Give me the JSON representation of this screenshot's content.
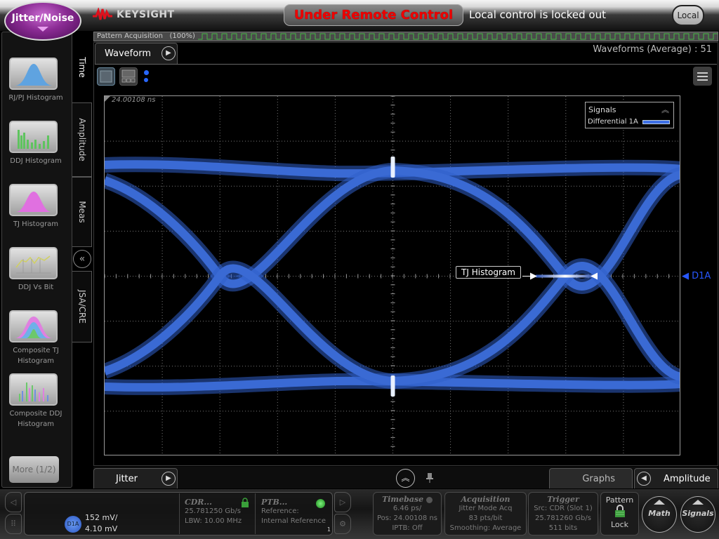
{
  "header": {
    "mode_button": "Jitter/Noise",
    "brand": "KEYSIGHT",
    "remote_status": "Under Remote Control",
    "lock_message": "Local control is locked out",
    "local_button": "Local"
  },
  "pattern_acquisition": {
    "label": "Pattern Acquisition",
    "percent": "(100%)",
    "progress_fraction": 1.0
  },
  "left_panel": {
    "tiles": [
      {
        "label": "RJ/PJ Histogram",
        "icon": "rj-pj-histogram-icon"
      },
      {
        "label": "DDJ Histogram",
        "icon": "ddj-histogram-icon"
      },
      {
        "label": "TJ Histogram",
        "icon": "tj-histogram-icon"
      },
      {
        "label": "DDJ Vs Bit",
        "icon": "ddj-vs-bit-icon"
      },
      {
        "label": "Composite TJ Histogram",
        "icon": "composite-tj-histogram-icon"
      },
      {
        "label": "Composite DDJ Histogram",
        "icon": "composite-ddj-histogram-icon"
      }
    ],
    "more_button": "More (1/2)"
  },
  "vertical_tabs": [
    {
      "label": "Time",
      "active": true
    },
    {
      "label": "Amplitude",
      "active": false
    },
    {
      "label": "Meas",
      "active": false
    },
    {
      "label": "JSA/CRE",
      "active": false
    }
  ],
  "waveform_panel": {
    "tab_label": "Waveform",
    "waveform_count": "Waveforms (Average) : 51",
    "time_position": "24.00108 ns",
    "legend": {
      "title": "Signals",
      "signal": "Differential 1A",
      "signal_color": "#3d6fe6"
    },
    "tj_histogram_label": "TJ Histogram",
    "channel_marker": "D1A",
    "trace_color": "#2f5fc8"
  },
  "bottom_tabs": {
    "left": "Jitter",
    "graphs": "Graphs",
    "right": "Amplitude"
  },
  "status_bar": {
    "channel": {
      "badge": "D1A",
      "scale": "152 mV/",
      "offset": "4.10 mV"
    },
    "cdr": {
      "title": "CDR...",
      "rate": "25.781250 Gb/s",
      "lbw": "LBW: 10.00 MHz"
    },
    "ptb": {
      "title": "PTB...",
      "line1": "Reference:",
      "line2": "Internal Reference",
      "corner": "1"
    },
    "timebase": {
      "title": "Timebase",
      "scale": "6.46 ps/",
      "pos": "Pos: 24.00108 ns",
      "iptb": "IPTB: Off"
    },
    "acquisition": {
      "title": "Acquisition",
      "mode": "Jitter Mode Acq",
      "pts": "83 pts/bit",
      "smoothing": "Smoothing: Average"
    },
    "trigger": {
      "title": "Trigger",
      "src": "Src: CDR (Slot 1)",
      "rate": "25.781260 Gb/s",
      "bits": "511 bits"
    },
    "pattern": {
      "title": "Pattern",
      "state": "Lock"
    },
    "math_button": "Math",
    "signals_button": "Signals"
  }
}
